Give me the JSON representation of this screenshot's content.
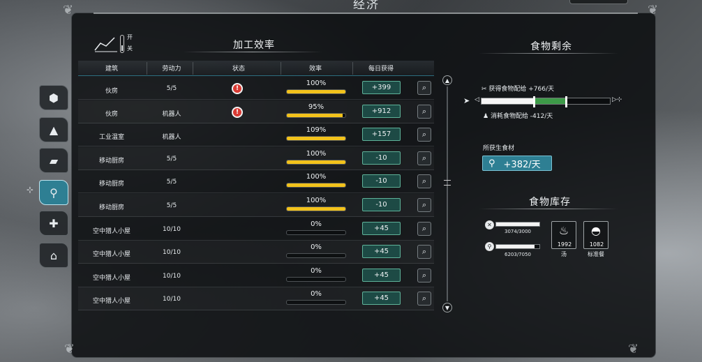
{
  "page": {
    "title": "经济"
  },
  "side_nav": [
    {
      "name": "nav-resources",
      "icon": "⬢",
      "active": false
    },
    {
      "name": "nav-wood",
      "icon": "▲",
      "active": false
    },
    {
      "name": "nav-materials",
      "icon": "▰",
      "active": false
    },
    {
      "name": "nav-food",
      "icon": "⚲",
      "active": true
    },
    {
      "name": "nav-health",
      "icon": "✚",
      "active": false
    },
    {
      "name": "nav-housing",
      "icon": "⌂",
      "active": false
    }
  ],
  "chart_toggle": {
    "on_label": "开",
    "off_label": "关"
  },
  "processing": {
    "title": "加工效率",
    "headers": {
      "building": "建筑",
      "labor": "劳动力",
      "status": "状态",
      "efficiency": "效率",
      "daily": "每日获得"
    },
    "rows": [
      {
        "building": "伙房",
        "labor": "5/5",
        "status": "alert",
        "efficiency": "100%",
        "eff_pct": 100,
        "daily": "+399"
      },
      {
        "building": "伙房",
        "labor": "机器人",
        "status": "alert",
        "efficiency": "95%",
        "eff_pct": 95,
        "daily": "+912"
      },
      {
        "building": "工业温室",
        "labor": "机器人",
        "status": "",
        "efficiency": "109%",
        "eff_pct": 100,
        "daily": "+157"
      },
      {
        "building": "移动厨房",
        "labor": "5/5",
        "status": "",
        "efficiency": "100%",
        "eff_pct": 100,
        "daily": "-10"
      },
      {
        "building": "移动厨房",
        "labor": "5/5",
        "status": "",
        "efficiency": "100%",
        "eff_pct": 100,
        "daily": "-10"
      },
      {
        "building": "移动厨房",
        "labor": "5/5",
        "status": "",
        "efficiency": "100%",
        "eff_pct": 100,
        "daily": "-10"
      },
      {
        "building": "空中猎人小屋",
        "labor": "10/10",
        "status": "",
        "efficiency": "0%",
        "eff_pct": 0,
        "daily": "+45"
      },
      {
        "building": "空中猎人小屋",
        "labor": "10/10",
        "status": "",
        "efficiency": "0%",
        "eff_pct": 0,
        "daily": "+45"
      },
      {
        "building": "空中猎人小屋",
        "labor": "10/10",
        "status": "",
        "efficiency": "0%",
        "eff_pct": 0,
        "daily": "+45"
      },
      {
        "building": "空中猎人小屋",
        "labor": "10/10",
        "status": "",
        "efficiency": "0%",
        "eff_pct": 0,
        "daily": "+45"
      }
    ]
  },
  "surplus": {
    "title": "食物剩余",
    "supply_label": "获得食物配给 +766/天",
    "consume_label": "消耗食物配给 -412/天",
    "supply_ratio": 0.66,
    "consume_ratio": 0.41
  },
  "raw": {
    "label": "所获生食材",
    "value": "+382/天"
  },
  "stock": {
    "title": "食物库存",
    "raw_value": "3074/3000",
    "raw_ratio": 1.0,
    "ration_value": "6203/7050",
    "ration_ratio": 0.88,
    "meals": [
      {
        "icon": "♨",
        "count": "1992",
        "name": "汤"
      },
      {
        "icon": "◓",
        "count": "1082",
        "name": "标准餐"
      }
    ]
  },
  "colors": {
    "accent": "#2e7f93",
    "bar_yellow": "#f2c21b",
    "daily_bg": "#1d4a45",
    "alert_red": "#d93a33",
    "supply_green": "#3d9a48"
  }
}
